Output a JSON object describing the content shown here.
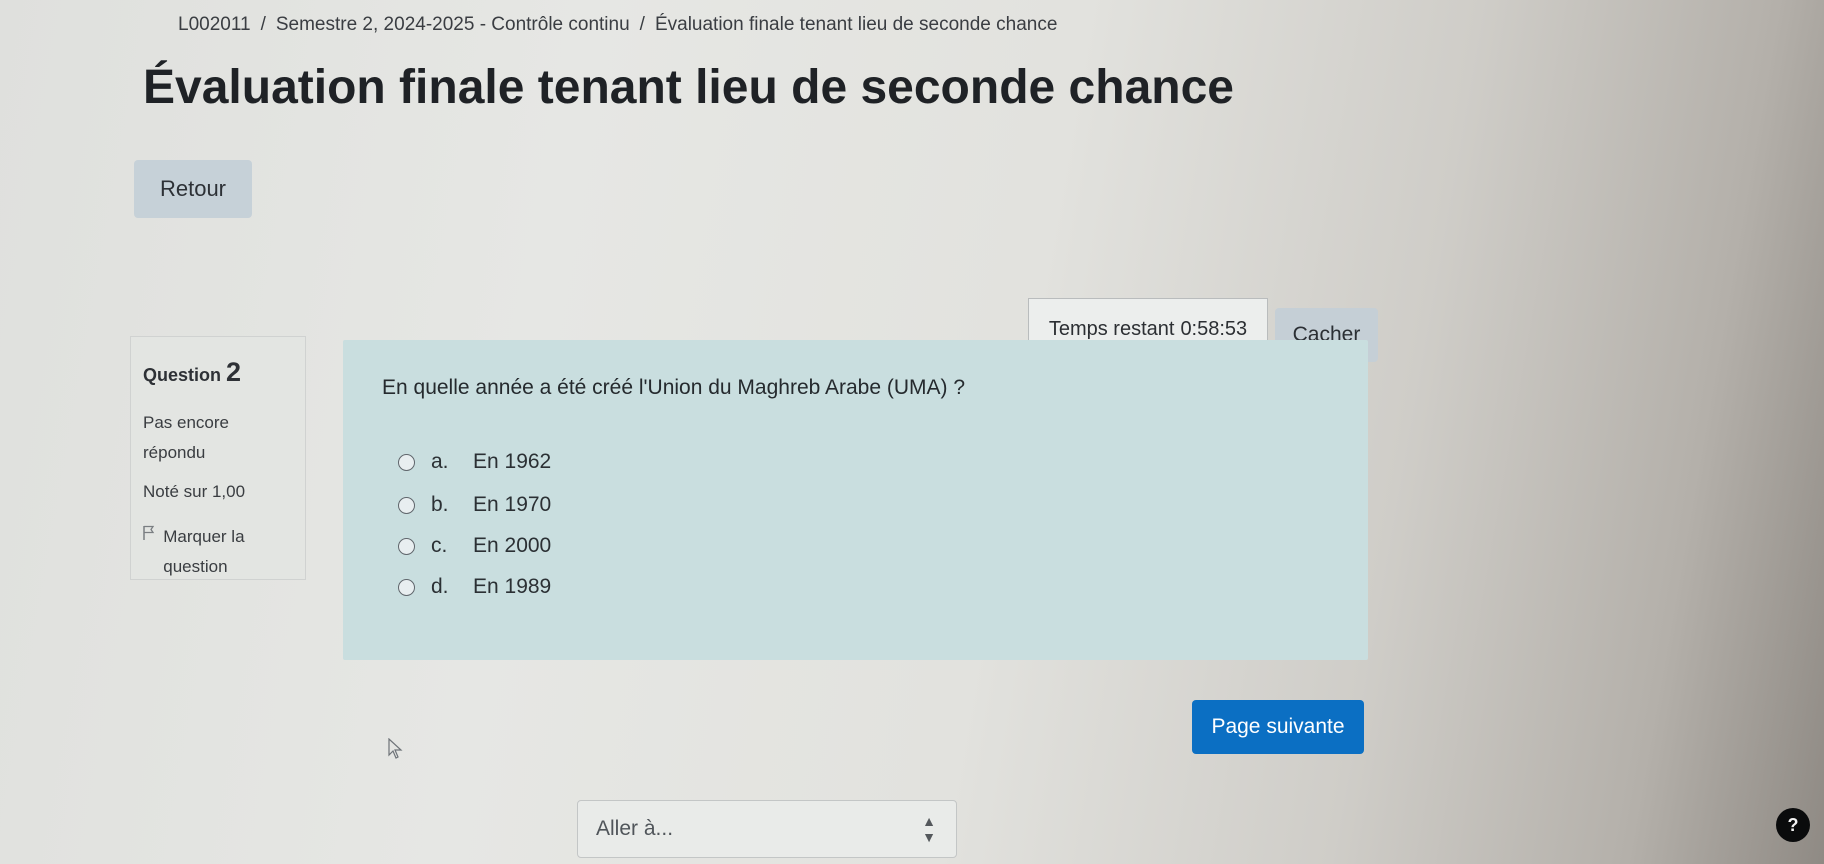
{
  "breadcrumb": {
    "items": [
      "L002011",
      "Semestre 2, 2024-2025 - Contrôle continu",
      "Évaluation finale tenant lieu de seconde chance"
    ],
    "separator": "/"
  },
  "page_title": "Évaluation finale tenant lieu de seconde chance",
  "back_button": "Retour",
  "timer": {
    "label": "Temps restant",
    "value": "0:58:53",
    "hide_button": "Cacher"
  },
  "question_info": {
    "label": "Question",
    "number": "2",
    "state": "Pas encore répondu",
    "grade": "Noté sur 1,00",
    "flag_label": "Marquer la question",
    "flag_icon": "flag-icon"
  },
  "question": {
    "text": "En quelle année a été créé l'Union du Maghreb Arabe (UMA) ?",
    "answers": [
      {
        "letter": "a.",
        "text": "En 1962",
        "selected": false
      },
      {
        "letter": "b.",
        "text": "En 1970",
        "selected": false
      },
      {
        "letter": "c.",
        "text": "En 2000",
        "selected": false
      },
      {
        "letter": "d.",
        "text": "En 1989",
        "selected": false
      }
    ]
  },
  "next_button": "Page suivante",
  "jump_to": {
    "selected": "Aller à..."
  },
  "help_button": "?",
  "colors": {
    "primary": "#0b6fc3",
    "question_panel": "#c9dedf",
    "secondary_button": "#c5cfd6"
  }
}
